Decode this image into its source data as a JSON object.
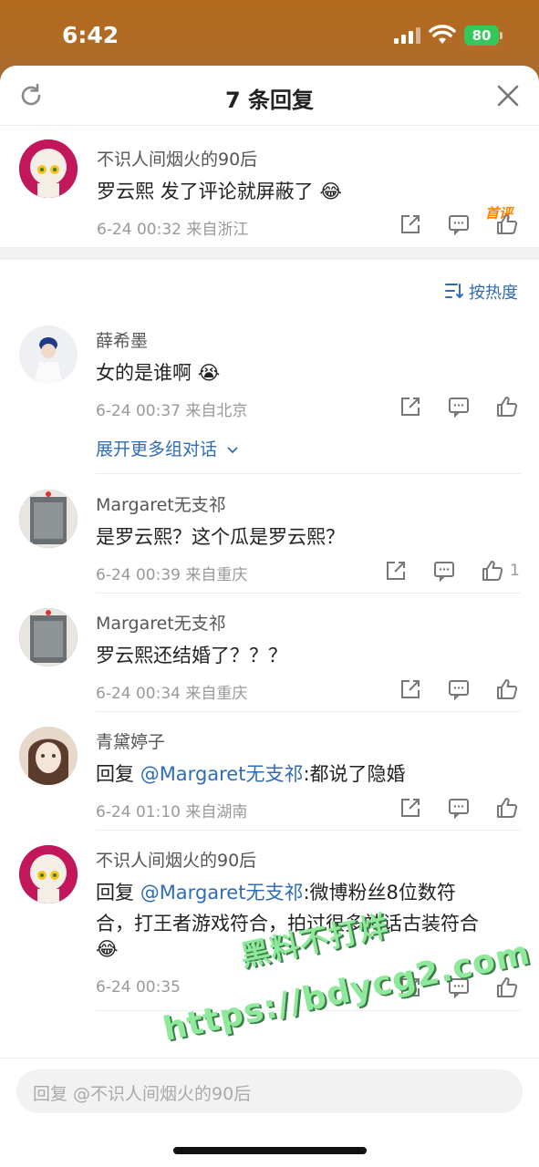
{
  "status_bar": {
    "time": "6:42",
    "battery": "80"
  },
  "header": {
    "title": "7 条回复"
  },
  "main_comment": {
    "author": "不识人间烟火的90后",
    "badge": "首评",
    "text": "罗云熙 发了评论就屏蔽了",
    "emoji": "😂",
    "meta": "6-24 00:32  来自浙江"
  },
  "sort": {
    "label": "按热度"
  },
  "replies": [
    {
      "author": "薛希墨",
      "text": "女的是谁啊",
      "emoji": "😭",
      "meta": "6-24 00:37  来自北京",
      "likes": "",
      "expand": "展开更多组对话"
    },
    {
      "author": "Margaret无支祁",
      "text": "是罗云熙？这个瓜是罗云熙？",
      "meta": "6-24 00:39  来自重庆",
      "likes": "1"
    },
    {
      "author": "Margaret无支祁",
      "text": "罗云熙还结婚了？？？",
      "meta": "6-24 00:34  来自重庆",
      "likes": ""
    },
    {
      "author": "青黛婷子",
      "reply_prefix": "回复 ",
      "mention": "@Margaret无支祁",
      "text": ":都说了隐婚",
      "meta": "6-24 01:10  来自湖南",
      "likes": ""
    },
    {
      "author": "不识人间烟火的90后",
      "reply_prefix": "回复 ",
      "mention": "@Margaret无支祁",
      "text_line1": ":微博粉丝8位数符",
      "text_line2": "合，打王者游戏符合，拍过很多神话古装符合",
      "emoji": "😂",
      "meta": "6-24 00:35",
      "likes": ""
    }
  ],
  "watermark": {
    "line1": "黑料不打烊",
    "line2": "https://bdycg2.com"
  },
  "reply_bar": {
    "placeholder": "回复 @不识人间烟火的90后"
  },
  "colors": {
    "link": "#2f6cb5",
    "badge": "#ff8200",
    "battery": "#34c759"
  }
}
